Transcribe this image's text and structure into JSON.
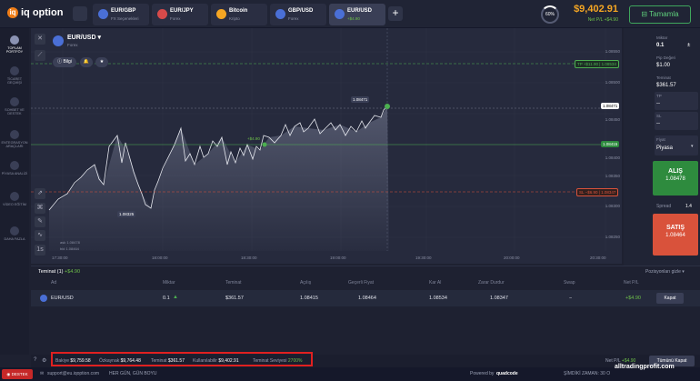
{
  "topbar": {
    "logo": "iq option",
    "tabs": [
      {
        "name": "EUR/GBP",
        "sub": "FX Seçenekleri",
        "color": "#4a6fd6"
      },
      {
        "name": "EUR/JPY",
        "sub": "Forex",
        "color": "#d64a4a"
      },
      {
        "name": "Bitcoin",
        "sub": "Kripto",
        "color": "#f5a623"
      },
      {
        "name": "GBP/USD",
        "sub": "Forex",
        "color": "#4a6fd6"
      },
      {
        "name": "EUR/USD",
        "sub": "+$4.90",
        "color": "#4a6fd6"
      }
    ],
    "level": "60%",
    "balance": "$9,402.91",
    "net_pl": "Net P/L +$4.90",
    "deposit": "Tamamla"
  },
  "left_nav": [
    {
      "label": "TOPLAM PORTFÖY",
      "icon": "portfolio-icon"
    },
    {
      "label": "TİCARET GEÇMİŞİ",
      "icon": "history-icon"
    },
    {
      "label": "SOHBET VE DESTEK",
      "icon": "chat-icon"
    },
    {
      "label": "ENTEGRASYON ARAÇLARI",
      "icon": "tools-icon"
    },
    {
      "label": "PİYASA ANALİZİ",
      "icon": "analysis-icon"
    },
    {
      "label": "VİDEO EĞİTİM",
      "icon": "video-icon"
    },
    {
      "label": "DAHA FAZLA",
      "icon": "more-icon"
    }
  ],
  "chart": {
    "pair": "EUR/USD",
    "market": "Forex",
    "info_label": "Bilgi",
    "y_ticks": [
      "1.08550",
      "1.08500",
      "1.08450",
      "1.08400",
      "1.08350",
      "1.08300",
      "1.08250"
    ],
    "x_ticks": [
      "17:30:00",
      "18:00:00",
      "18:30:00",
      "19:00:00",
      "19:30:00",
      "20:00:00",
      "20:30:00"
    ],
    "tp_tag": "TP +$11.90",
    "tp_value": "1.08534",
    "sl_tag": "SL −$6.90",
    "sl_value": "1.08347",
    "current_price": "1.08471",
    "open_price": "1.08415",
    "entry_label": "+$4.90",
    "high_label": "1.08471",
    "low_label": "1.08325",
    "scale_label_1": "ask 1.08478",
    "scale_label_2": "bid 1.08464"
  },
  "right_panel": {
    "amount_label": "Miktar",
    "amount": "0.1",
    "pip_label": "Pip Değeri",
    "pip": "$1.00",
    "margin_label": "Teminat",
    "margin": "$361.57",
    "tp_label": "TP",
    "tp": "--",
    "sl_label": "SL",
    "sl": "--",
    "price_label": "Fiyat",
    "price": "Piyasa",
    "buy_label": "ALIŞ",
    "buy_price": "1.08478",
    "spread_label": "Spread",
    "spread": "1.4",
    "sell_label": "SATIŞ",
    "sell_price": "1.08464"
  },
  "positions": {
    "title": "Teminat (1)",
    "title_pl": "+$4.90",
    "group_label": "Pozisyonları gizle",
    "headers": [
      "Ad",
      "Miktar",
      "Teminat",
      "Açılış",
      "Geçerli Fiyat",
      "Kar Al",
      "Zarar Durdur",
      "Swap",
      "Net P/L"
    ],
    "row": [
      "EUR/USD",
      "0.1",
      "$361.57",
      "1.08415",
      "1.08464",
      "1.08534",
      "1.08347",
      "−",
      "+$4.90"
    ],
    "close_label": "Kapat"
  },
  "summary": {
    "bakiye_label": "Bakiye",
    "bakiye": "$9,759.58",
    "ozkaynak_label": "Özkaynak",
    "ozkaynak": "$9,764.48",
    "teminat_label": "Teminat",
    "teminat": "$361.57",
    "kullanilabilir_label": "Kullanılabilir",
    "kullanilabilir": "$9,402.91",
    "seviye_label": "Teminat Seviyesi",
    "seviye": "2700%",
    "net_pl_label": "Net P/L",
    "net_pl": "+$4.90",
    "close_all": "Tümünü Kapat"
  },
  "footer": {
    "support_btn": "DESTEK",
    "email": "support@eu.iqoption.com",
    "slogan": "HER GÜN, GÜN BOYU",
    "powered": "Powered by",
    "brand": "quadcode",
    "time": "ŞİMDİKİ ZAMAN: 30 O",
    "watermark": "alltradingprofit.com"
  },
  "colors": {
    "accent": "#6ec04a",
    "buy": "#2e8b3e",
    "sell": "#d9523b",
    "highlight": "#e02020",
    "balance": "#f5a623"
  }
}
